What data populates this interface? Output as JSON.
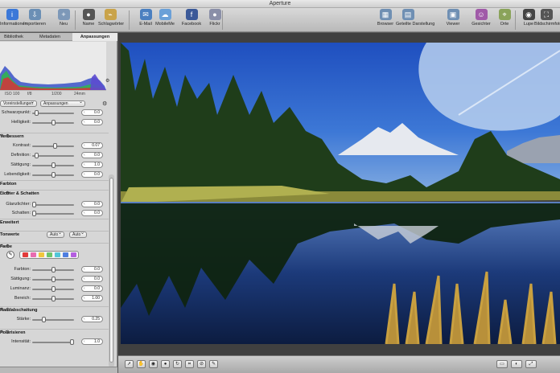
{
  "window": {
    "title": "Aperture"
  },
  "toolbar": {
    "items": [
      {
        "label": "Informationen",
        "icon": "info-icon",
        "color": "#3b78d8"
      },
      {
        "label": "Importieren",
        "icon": "import-icon",
        "color": "#6b8fb5"
      },
      {
        "label": "Neu",
        "icon": "new-icon",
        "color": "#7d98b8"
      },
      {
        "label": "Name",
        "icon": "person-icon",
        "color": "#555555"
      },
      {
        "label": "Schlagwörter",
        "icon": "keywords-icon",
        "color": "#c9a34a"
      },
      {
        "label": "E-Mail",
        "icon": "email-icon",
        "color": "#4a7fc0"
      },
      {
        "label": "MobileMe",
        "icon": "cloud-icon",
        "color": "#6aa0d8"
      },
      {
        "label": "Facebook",
        "icon": "facebook-icon",
        "color": "#3b5998"
      },
      {
        "label": "Flickr",
        "icon": "flickr-icon",
        "color": "#8a8fa8"
      },
      {
        "label": "Browser",
        "icon": "browser-icon",
        "color": "#6f8fb3"
      },
      {
        "label": "Geteilte Darstellung",
        "icon": "split-view-icon",
        "color": "#6f8fb3"
      },
      {
        "label": "Viewer",
        "icon": "viewer-icon",
        "color": "#6f8fb3"
      },
      {
        "label": "Gesichter",
        "icon": "faces-icon",
        "color": "#a05aa8"
      },
      {
        "label": "Orte",
        "icon": "places-icon",
        "color": "#8aa35a"
      },
      {
        "label": "Lupe",
        "icon": "loupe-icon",
        "color": "#444444"
      },
      {
        "label": "Bildschirmfoto",
        "icon": "fullscreen-icon",
        "color": "#555555"
      }
    ]
  },
  "inspector": {
    "tabs": [
      "Bibliothek",
      "Metadaten",
      "Anpassungen"
    ],
    "active_tab": "Anpassungen",
    "exif": {
      "iso": "ISO 100",
      "aperture": "f/8",
      "shutter": "1/200",
      "focal": "24mm"
    },
    "presets": {
      "presets_label": "Voreinstellungen",
      "adjust_label": "Anpassungen"
    },
    "levels": [
      {
        "label": "Schwarzpunkt:",
        "value": "0.0",
        "knob": 0.07
      },
      {
        "label": "Helligkeit:",
        "value": "0.0",
        "knob": 0.5
      }
    ],
    "verbessern": {
      "title": "Verbessern",
      "rows": [
        {
          "label": "Kontrast:",
          "value": "0.07",
          "knob": 0.55
        },
        {
          "label": "Definition:",
          "value": "0.0",
          "knob": 0.07
        },
        {
          "label": "Sättigung:",
          "value": "1.0",
          "knob": 0.5
        },
        {
          "label": "Lebendigkeit:",
          "value": "0.0",
          "knob": 0.5
        }
      ]
    },
    "farbton_label": "Farbton",
    "lichter": {
      "title": "Lichter & Schatten",
      "rows": [
        {
          "label": "Glanzlichter:",
          "value": "0.0",
          "knob": 0.0
        },
        {
          "label": "Schatten:",
          "value": "0.0",
          "knob": 0.0
        }
      ]
    },
    "erweitert_label": "Erweitert",
    "tonwerte": {
      "title": "Tonwerte",
      "auto1": "Auto",
      "auto2": "Auto"
    },
    "farbe": {
      "title": "Farbe",
      "swatches": [
        "#e23b3b",
        "#e86bb0",
        "#f0c63c",
        "#6ec46b",
        "#52c6d8",
        "#4e7ee0",
        "#b45ee0"
      ],
      "rows": [
        {
          "label": "Farbton:",
          "value": "0.0",
          "knob": 0.5
        },
        {
          "label": "Sättigung:",
          "value": "0.0",
          "knob": 0.5
        },
        {
          "label": "Luminanz:",
          "value": "0.0",
          "knob": 0.5
        },
        {
          "label": "Bereich:",
          "value": "1.00",
          "knob": 0.5
        }
      ]
    },
    "randabschattung": {
      "title": "Randabschattung",
      "rows": [
        {
          "label": "Stärke:",
          "value": "0.25",
          "knob": 0.25
        }
      ]
    },
    "polarisieren": {
      "title": "Polarisieren",
      "rows": [
        {
          "label": "Intensität:",
          "value": "1.0",
          "knob": 1.0
        }
      ]
    }
  },
  "bottombar": {
    "tools": [
      "pointer-icon",
      "hand-icon",
      "redeye-icon",
      "spot-icon",
      "rotate-icon",
      "crop-icon",
      "straighten-icon",
      "brush-icon"
    ]
  }
}
